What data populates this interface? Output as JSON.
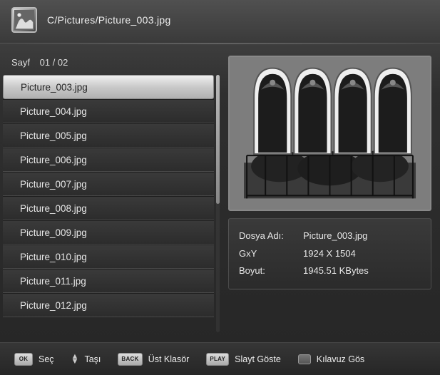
{
  "breadcrumb": "C/Pictures/Picture_003.jpg",
  "page": {
    "label": "Sayf",
    "value": "01 / 02"
  },
  "files": [
    {
      "name": "Picture_003.jpg",
      "selected": true
    },
    {
      "name": "Picture_004.jpg",
      "selected": false
    },
    {
      "name": "Picture_005.jpg",
      "selected": false
    },
    {
      "name": "Picture_006.jpg",
      "selected": false
    },
    {
      "name": "Picture_007.jpg",
      "selected": false
    },
    {
      "name": "Picture_008.jpg",
      "selected": false
    },
    {
      "name": "Picture_009.jpg",
      "selected": false
    },
    {
      "name": "Picture_010.jpg",
      "selected": false
    },
    {
      "name": "Picture_011.jpg",
      "selected": false
    },
    {
      "name": "Picture_012.jpg",
      "selected": false
    }
  ],
  "info": {
    "filename_label": "Dosya Adı:",
    "filename_value": "Picture_003.jpg",
    "dims_label": "GxY",
    "dims_value": "1924 X 1504",
    "size_label": "Boyut:",
    "size_value": "1945.51 KBytes"
  },
  "footer": {
    "ok_key": "OK",
    "ok_label": "Seç",
    "move_label": "Taşı",
    "back_key": "BACK",
    "back_label": "Üst Klasör",
    "play_key": "PLAY",
    "play_label": "Slayt Göste",
    "guide_label": "Kılavuz Gös"
  }
}
